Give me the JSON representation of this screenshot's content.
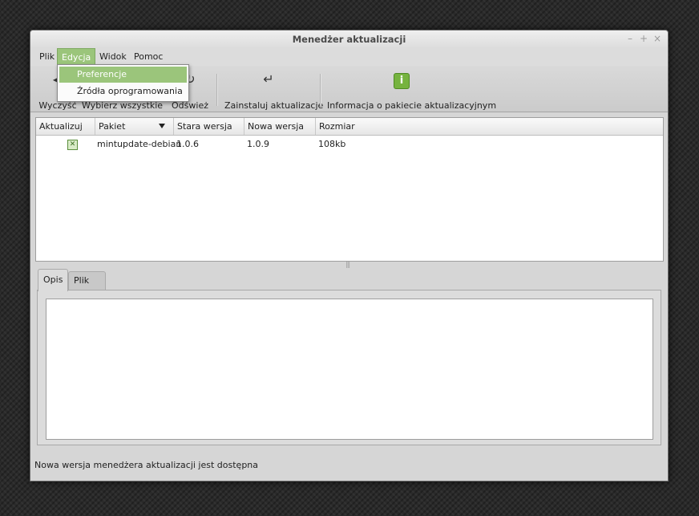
{
  "window": {
    "title": "Menedżer aktualizacji",
    "controls": {
      "minimize": "–",
      "maximize": "+",
      "close": "×"
    }
  },
  "menubar": {
    "items": [
      {
        "label": "Plik"
      },
      {
        "label": "Edycja"
      },
      {
        "label": "Widok"
      },
      {
        "label": "Pomoc"
      }
    ]
  },
  "dropdown": {
    "items": [
      {
        "label": "Preferencje"
      },
      {
        "label": "Źródła oprogramowania"
      }
    ]
  },
  "toolbar": {
    "buttons": [
      {
        "label": "Wyczyść",
        "icon": "clear-icon"
      },
      {
        "label": "Wybierz wszystkie",
        "icon": "select-all-icon"
      },
      {
        "label": "Odśwież",
        "icon": "refresh-icon"
      },
      {
        "label": "Zainstaluj aktualizacje",
        "icon": "install-icon"
      },
      {
        "label": "Informacja o pakiecie aktualizacyjnym",
        "icon": "info-icon"
      }
    ]
  },
  "table": {
    "columns": [
      "Aktualizuj",
      "Pakiet",
      "Stara wersja",
      "Nowa wersja",
      "Rozmiar"
    ],
    "rows": [
      {
        "update": true,
        "package": "mintupdate-debian",
        "old_version": "1.0.6",
        "new_version": "1.0.9",
        "size": "108kb"
      }
    ]
  },
  "tabs": [
    {
      "label": "Opis",
      "active": true
    },
    {
      "label": "Plik zmian",
      "active": false
    }
  ],
  "status": "Nowa wersja menedżera aktualizacji jest dostępna",
  "colors": {
    "accent": "#9bc57b",
    "window_bg": "#d6d6d6",
    "info_icon": "#76b33f"
  }
}
